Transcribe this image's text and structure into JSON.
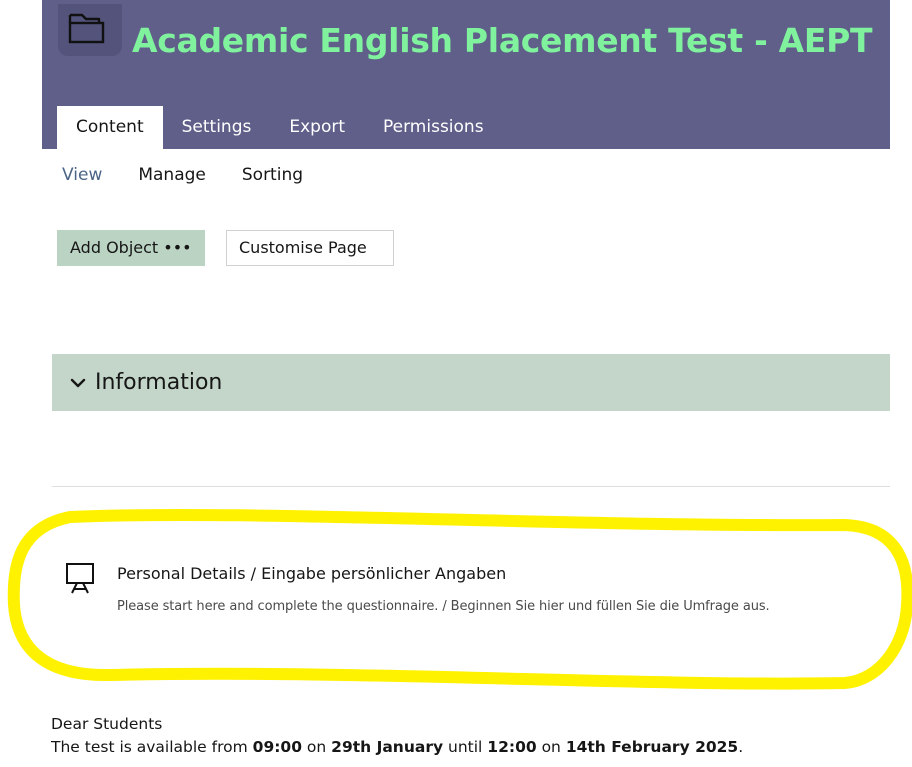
{
  "header": {
    "title": "Academic English Placement Test - AEPT",
    "folder_icon": "folder-icon",
    "background_color": "#5f5f8a",
    "title_color": "#80f29e"
  },
  "tabs": [
    {
      "label": "Content",
      "active": true
    },
    {
      "label": "Settings",
      "active": false
    },
    {
      "label": "Export",
      "active": false
    },
    {
      "label": "Permissions",
      "active": false
    }
  ],
  "subtabs": [
    {
      "label": "View",
      "active": true
    },
    {
      "label": "Manage",
      "active": false
    },
    {
      "label": "Sorting",
      "active": false
    }
  ],
  "actions": {
    "add_object_label": "Add Object •••",
    "customise_page_label": "Customise Page"
  },
  "accordion": {
    "label": "Information",
    "icon": "chevron-down-icon",
    "expanded": true,
    "background_color": "#c3d6c9"
  },
  "item": {
    "icon": "presentation-board-icon",
    "title": "Personal Details / Eingabe persönlicher Angaben",
    "description": "Please start here and complete the questionnaire. / Beginnen Sie hier und füllen Sie die Umfrage aus.",
    "highlight_color": "#fff200"
  },
  "info": {
    "greeting": "Dear Students",
    "availability": {
      "prefix": "The test is available from ",
      "start_time": "09:00",
      "on1": " on ",
      "start_date": "29th January",
      "until": " until ",
      "end_time": "12:00",
      "on2": " on ",
      "end_date": "14th February 2025",
      "suffix": "."
    }
  }
}
